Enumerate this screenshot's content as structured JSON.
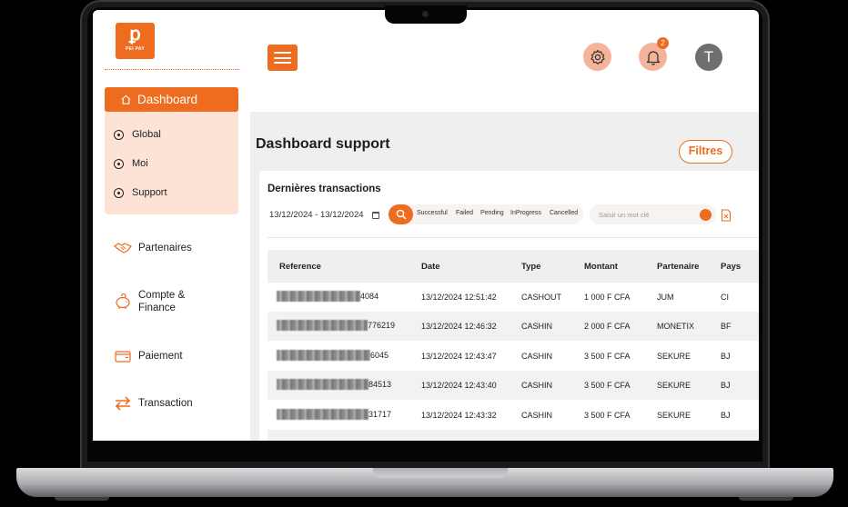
{
  "brand": {
    "logo_text": "PEI PAY"
  },
  "sidebar": {
    "active_item": "Dashboard",
    "subitems": [
      "Global",
      "Moi",
      "Support"
    ],
    "items": [
      "Partenaires",
      "Compte &",
      "Finance",
      "Paiement",
      "Transaction"
    ]
  },
  "header": {
    "notification_count": "2",
    "avatar_initial": "T"
  },
  "main": {
    "title": "Dashboard support",
    "filters_label": "Filtres",
    "card_title": "Dernières transactions",
    "date_range": "13/12/2024 - 13/12/2024",
    "status_filters": [
      "Successful",
      "Failed",
      "Pending",
      "InProgress",
      "Cancelled"
    ],
    "search_placeholder": "Saisir un mot clé"
  },
  "table": {
    "columns": [
      "Reference",
      "Date",
      "Type",
      "Montant",
      "Partenaire",
      "Pays"
    ],
    "rows": [
      {
        "ref_suffix": "4084",
        "date": "13/12/2024 12:51:42",
        "type": "CASHOUT",
        "amount": "1 000 F CFA",
        "partner": "JUM",
        "country": "CI"
      },
      {
        "ref_suffix": "776219",
        "date": "13/12/2024 12:46:32",
        "type": "CASHIN",
        "amount": "2 000 F CFA",
        "partner": "MONETIX",
        "country": "BF"
      },
      {
        "ref_suffix": "6045",
        "date": "13/12/2024 12:43:47",
        "type": "CASHIN",
        "amount": "3 500 F CFA",
        "partner": "SEKURE",
        "country": "BJ"
      },
      {
        "ref_suffix": "84513",
        "date": "13/12/2024 12:43:40",
        "type": "CASHIN",
        "amount": "3 500 F CFA",
        "partner": "SEKURE",
        "country": "BJ"
      },
      {
        "ref_suffix": "31717",
        "date": "13/12/2024 12:43:32",
        "type": "CASHIN",
        "amount": "3 500 F CFA",
        "partner": "SEKURE",
        "country": "BJ"
      }
    ]
  },
  "colors": {
    "accent": "#ee6c1f",
    "accent_light": "#fde3d6",
    "icon_bg": "#f5b49a",
    "avatar_bg": "#6f6f6f"
  }
}
